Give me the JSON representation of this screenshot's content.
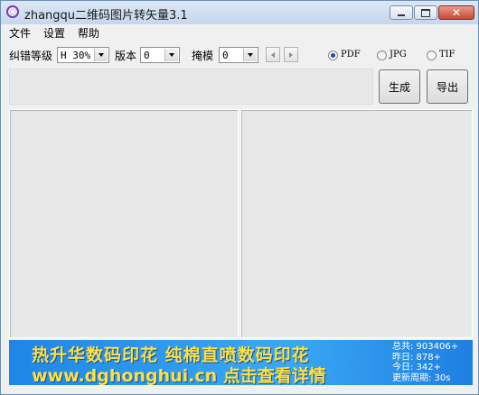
{
  "window": {
    "title": "zhangqu二维码图片转矢量3.1",
    "icon": "app-logo-icon",
    "controls": {
      "minimize": "minimize-icon",
      "maximize": "maximize-icon",
      "close": "close-icon",
      "close_glyph": "✕"
    }
  },
  "menu": [
    {
      "label": "文件"
    },
    {
      "label": "设置"
    },
    {
      "label": "帮助"
    }
  ],
  "toolbar": {
    "error_level_label": "纠错等级",
    "error_level_value": "H 30%",
    "version_label": "版本",
    "version_value": "0",
    "mask_label": "掩模",
    "mask_value": "0",
    "spin_left_icon": "arrow-left-icon",
    "spin_right_icon": "arrow-right-icon"
  },
  "formats": [
    {
      "label": "PDF",
      "checked": true
    },
    {
      "label": "JPG",
      "checked": false
    },
    {
      "label": "TIF",
      "checked": false
    }
  ],
  "actions": {
    "generate_label": "生成",
    "export_label": "导出"
  },
  "banner": {
    "line1": "热升华数码印花 纯棉直喷数码印花",
    "line2": "www.dghonghui.cn 点击查看详情",
    "stats": [
      "总共: 903406+",
      "昨日: 878+",
      "今日: 342+",
      "更新周期: 30s"
    ]
  },
  "colors": {
    "banner_text": "#ffe040",
    "banner_bg": "#2a97ee",
    "radio_dot": "#1f4f92"
  }
}
